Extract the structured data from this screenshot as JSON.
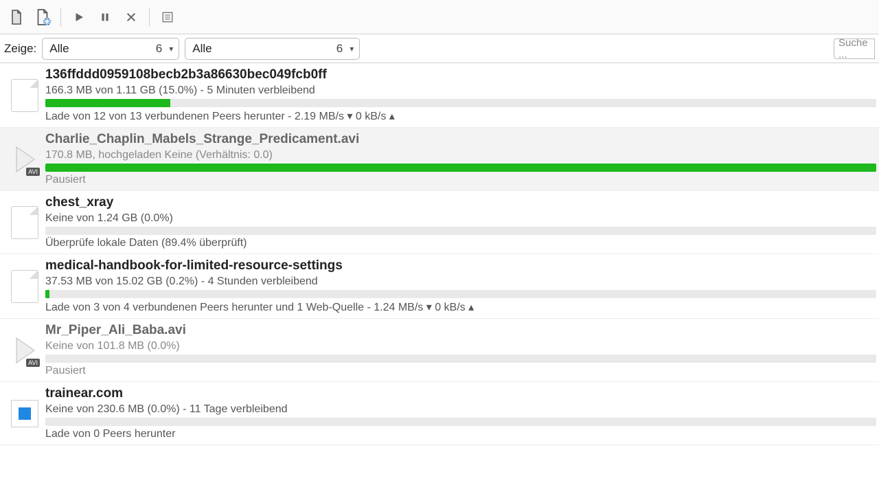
{
  "filterbar": {
    "label": "Zeige:",
    "dropdown1": {
      "text": "Alle",
      "count": "6"
    },
    "dropdown2": {
      "text": "Alle",
      "count": "6"
    },
    "search_placeholder": "Suche ..."
  },
  "torrents": [
    {
      "icon": "file",
      "title": "136ffddd0959108becb2b3a86630bec049fcb0ff",
      "title_gray": false,
      "status": "166.3 MB von 1.11 GB (15.0%) - 5 Minuten verbleibend",
      "status_gray": false,
      "progress_pct": 15.0,
      "progress_class": "",
      "peers": "Lade von 12 von 13 verbundenen Peers herunter - 2.19 MB/s ▾   0 kB/s ▴",
      "peers_gray": false,
      "selected": false
    },
    {
      "icon": "video",
      "title": "Charlie_Chaplin_Mabels_Strange_Predicament.avi",
      "title_gray": true,
      "status": "170.8 MB, hochgeladen Keine (Verhältnis: 0.0)",
      "status_gray": true,
      "progress_pct": 100,
      "progress_class": "",
      "peers": "Pausiert",
      "peers_gray": true,
      "selected": true
    },
    {
      "icon": "file",
      "title": "chest_xray",
      "title_gray": false,
      "status": "Keine von 1.24 GB (0.0%)",
      "status_gray": false,
      "progress_pct": 0,
      "progress_class": "",
      "peers": "Überprüfe lokale Daten (89.4% überprüft)",
      "peers_gray": false,
      "selected": false
    },
    {
      "icon": "file",
      "title": "medical-handbook-for-limited-resource-settings",
      "title_gray": false,
      "status": "37.53 MB von 15.02 GB (0.2%) - 4 Stunden verbleibend",
      "status_gray": false,
      "progress_pct": 0.5,
      "progress_class": "",
      "peers": "Lade von 3 von 4 verbundenen Peers herunter und 1 Web-Quelle - 1.24 MB/s ▾   0 kB/s ▴",
      "peers_gray": false,
      "selected": false
    },
    {
      "icon": "video",
      "title": "Mr_Piper_Ali_Baba.avi",
      "title_gray": true,
      "status": "Keine von 101.8 MB (0.0%)",
      "status_gray": true,
      "progress_pct": 0,
      "progress_class": "",
      "peers": "Pausiert",
      "peers_gray": true,
      "selected": false
    },
    {
      "icon": "folder",
      "title": "trainear.com",
      "title_gray": false,
      "status": "Keine von 230.6 MB (0.0%) - 11 Tage verbleibend",
      "status_gray": false,
      "progress_pct": 0,
      "progress_class": "",
      "peers": "Lade von 0 Peers herunter",
      "peers_gray": false,
      "selected": false
    }
  ]
}
